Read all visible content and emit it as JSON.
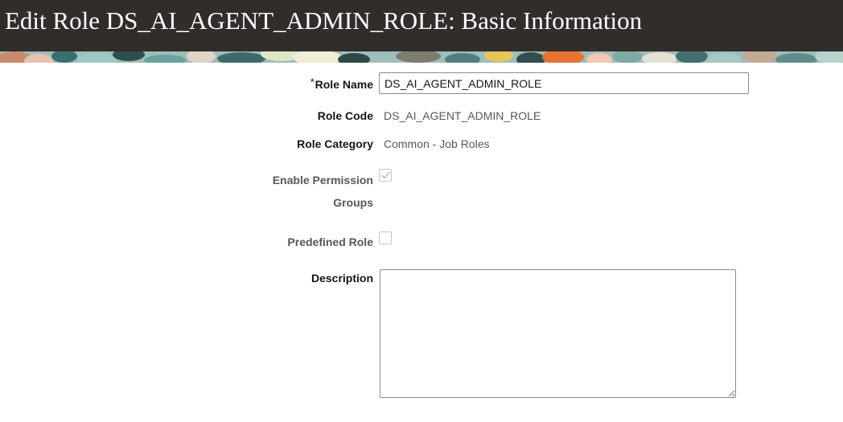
{
  "page": {
    "title": "Edit Role DS_AI_AGENT_ADMIN_ROLE: Basic Information"
  },
  "form": {
    "role_name": {
      "required_marker": "*",
      "label": "Role Name",
      "value": "DS_AI_AGENT_ADMIN_ROLE"
    },
    "role_code": {
      "label": "Role Code",
      "value": "DS_AI_AGENT_ADMIN_ROLE"
    },
    "role_category": {
      "label": "Role Category",
      "value": "Common - Job Roles"
    },
    "enable_permission_groups": {
      "label_line1": "Enable Permission",
      "label_line2": "Groups",
      "checked": true,
      "disabled": true
    },
    "predefined_role": {
      "label": "Predefined Role",
      "checked": false,
      "disabled": true
    },
    "description": {
      "label": "Description",
      "value": ""
    }
  },
  "colors": {
    "header_bg": "#312d2a",
    "header_text": "#ffffff",
    "required_marker": "#1f5c99"
  },
  "icons": {
    "checkmark": "check-icon"
  }
}
